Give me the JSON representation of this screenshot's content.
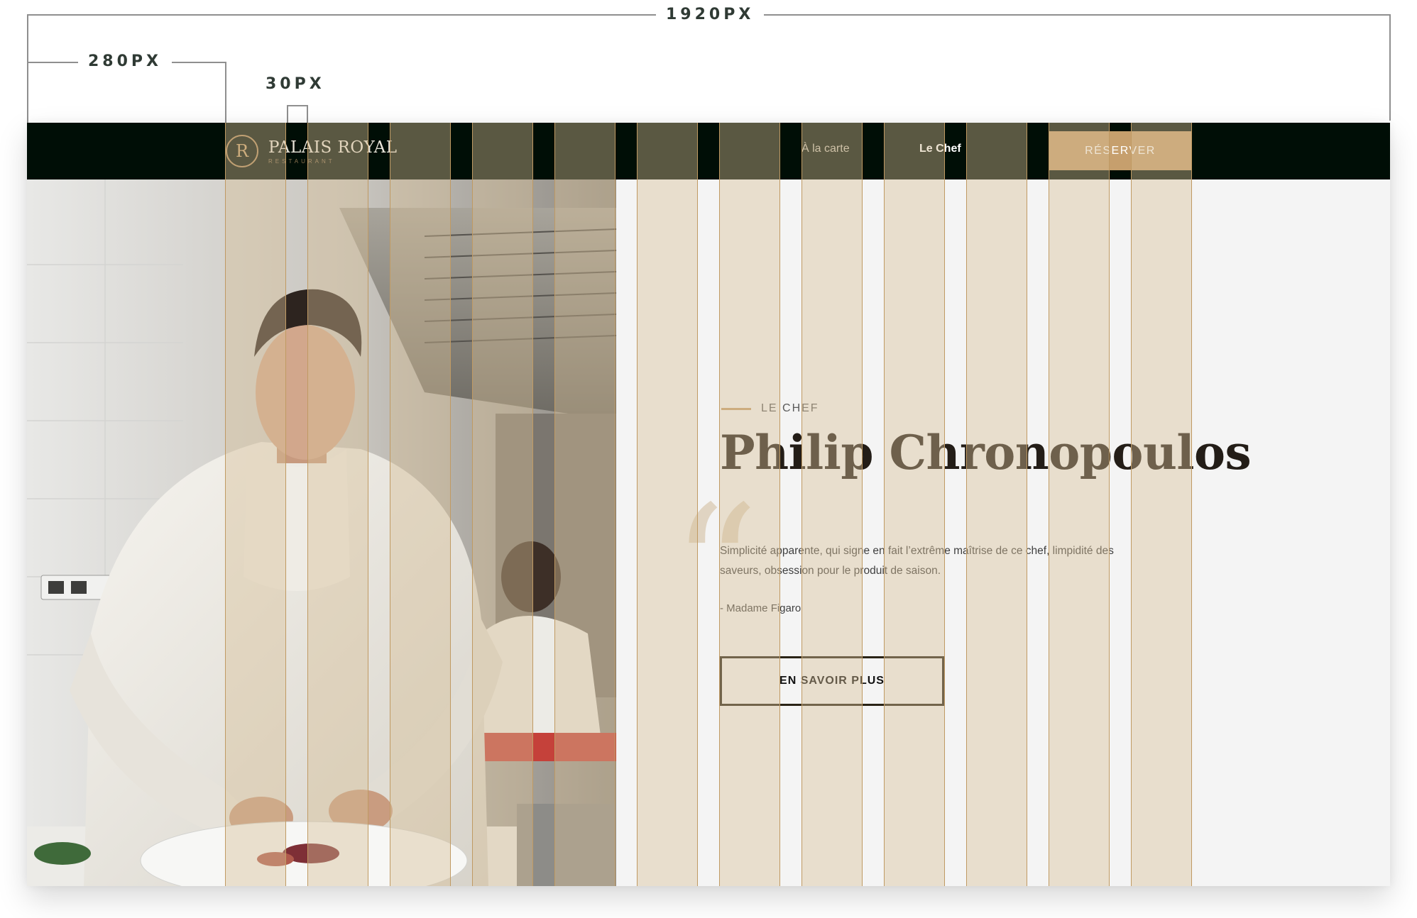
{
  "annotations": {
    "page_width": "1920PX",
    "margin_width": "280PX",
    "gutter_width": "30PX"
  },
  "navbar": {
    "logo_monogram": "R",
    "logo_name": "PALAIS ROYAL",
    "logo_subtitle": "RESTAURANT",
    "links": [
      {
        "label": "À la carte",
        "active": false
      },
      {
        "label": "Le Chef",
        "active": true
      }
    ],
    "reserve_label": "RÉSERVER"
  },
  "hero": {
    "eyebrow": "LE CHEF",
    "name": "Philip Chronopoulos",
    "quote_mark": "“",
    "quote": "Simplicité apparente, qui signe en fait l’extrême maîtrise de ce chef, limpidité des saveurs, obsession pour le produit de saison.",
    "source": "- Madame Figaro",
    "cta_label": "EN SAVOIR PLUS"
  },
  "grid": {
    "columns": 12,
    "color": "#d6be96"
  },
  "colors": {
    "navbar_bg": "#000e06",
    "accent": "#c69f6d",
    "page_bg": "#f4f4f4",
    "heading": "#231d17"
  }
}
